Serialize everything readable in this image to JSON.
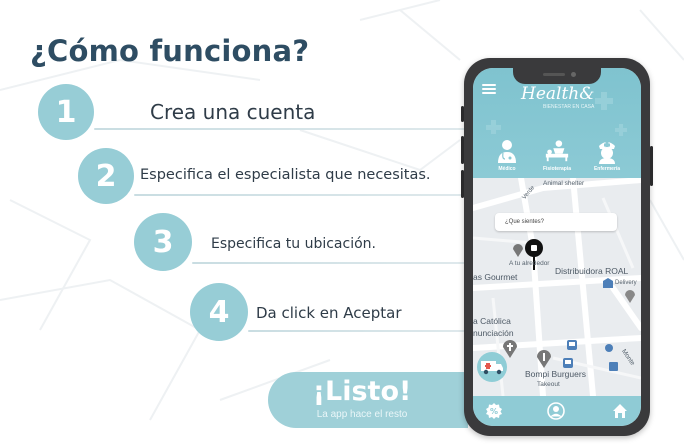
{
  "title": "¿Cómo funciona?",
  "steps": [
    {
      "number": "1",
      "text": "Crea una cuenta"
    },
    {
      "number": "2",
      "text": "Especifica el especialista que necesitas."
    },
    {
      "number": "3",
      "text": "Especifica tu ubicación."
    },
    {
      "number": "4",
      "text": "Da click en Aceptar"
    }
  ],
  "cta": {
    "main": "¡Listo!",
    "sub": "La app hace el resto"
  },
  "phone": {
    "logo": "Health&",
    "logo_sub": "BIENESTAR EN CASA",
    "categories": [
      {
        "label": "Médico",
        "icon": "doctor-icon"
      },
      {
        "label": "Fisioterapia",
        "icon": "massage-icon"
      },
      {
        "label": "Enfermería",
        "icon": "nurse-icon"
      }
    ],
    "search_placeholder": "¿Que sientes?",
    "map_labels": {
      "animal_shelter": "Animal shelter",
      "verde": "Verde",
      "tu_alrededor": "A tu alrededor",
      "gourmet": "as Gourmet",
      "distribuidora": "Distribuidora ROAL",
      "delivery": "Delivery",
      "catolica": "a Católica",
      "anunciacion": "nunciación",
      "bompi": "Bompi Burguers",
      "takeout": "Takeout",
      "monte": "Monte"
    },
    "bottom_icons": [
      "discount-icon",
      "profile-icon",
      "home-icon"
    ]
  },
  "colors": {
    "accent": "#97cdd6",
    "title": "#2e4d63",
    "header": "#8ccad5"
  }
}
